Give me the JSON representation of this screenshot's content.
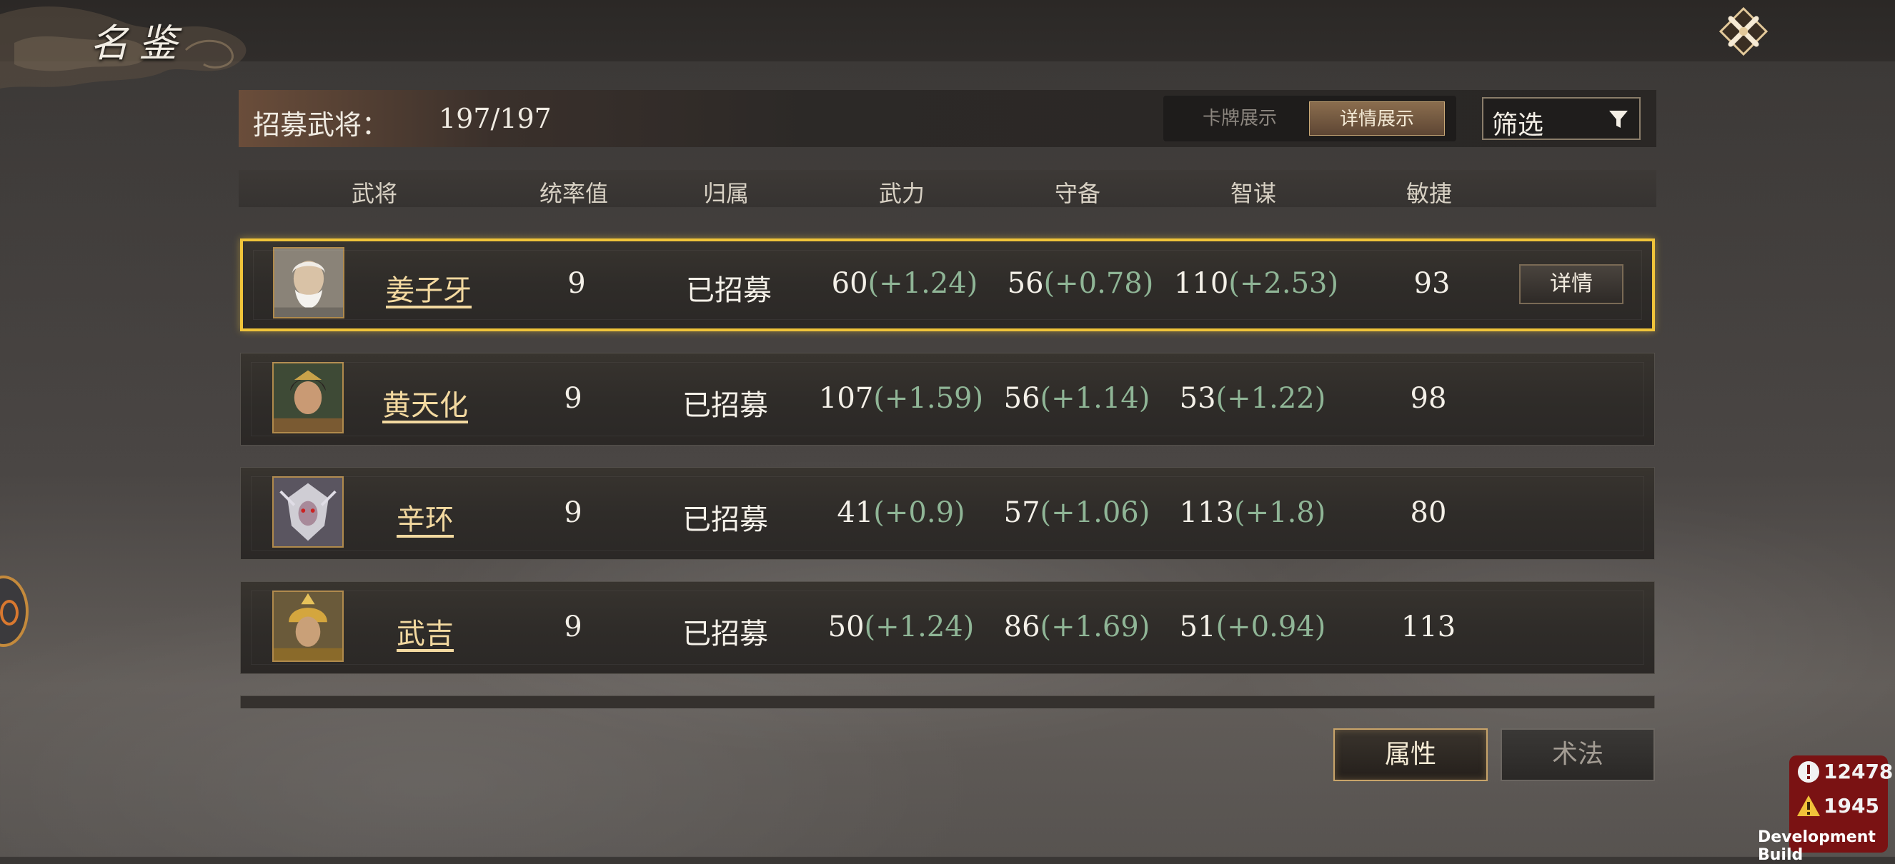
{
  "page_title": "名鉴",
  "header": {
    "recruit_label": "招募武将：",
    "recruit_count": "197/197",
    "view_tabs": {
      "card": "卡牌展示",
      "detail": "详情展示",
      "active": "detail"
    },
    "filter_label": "筛选"
  },
  "columns": {
    "general": "武将",
    "command": "统率值",
    "affiliation": "归属",
    "force": "武力",
    "defense": "守备",
    "intelligence": "智谋",
    "agility": "敏捷"
  },
  "rows": [
    {
      "name": "姜子牙",
      "command": "9",
      "status": "已招募",
      "force": "60",
      "force_bonus": "(+1.24)",
      "defense": "56",
      "defense_bonus": "(+0.78)",
      "intel": "110",
      "intel_bonus": "(+2.53)",
      "agility": "93",
      "selected": true,
      "detail_label": "详情"
    },
    {
      "name": "黄天化",
      "command": "9",
      "status": "已招募",
      "force": "107",
      "force_bonus": "(+1.59)",
      "defense": "56",
      "defense_bonus": "(+1.14)",
      "intel": "53",
      "intel_bonus": "(+1.22)",
      "agility": "98",
      "selected": false
    },
    {
      "name": "辛环",
      "command": "9",
      "status": "已招募",
      "force": "41",
      "force_bonus": "(+0.9)",
      "defense": "57",
      "defense_bonus": "(+1.06)",
      "intel": "113",
      "intel_bonus": "(+1.8)",
      "agility": "80",
      "selected": false
    },
    {
      "name": "武吉",
      "command": "9",
      "status": "已招募",
      "force": "50",
      "force_bonus": "(+1.24)",
      "defense": "86",
      "defense_bonus": "(+1.69)",
      "intel": "51",
      "intel_bonus": "(+0.94)",
      "agility": "113",
      "selected": false
    }
  ],
  "bottom_tabs": {
    "attributes": "属性",
    "skills": "术法"
  },
  "debug": {
    "errors": "12478",
    "warnings": "1945",
    "build_label": "Development Build"
  },
  "colors": {
    "selected_border": "#f0c43a",
    "bonus_text": "#8fb596",
    "name_text": "#f3d9a0"
  }
}
